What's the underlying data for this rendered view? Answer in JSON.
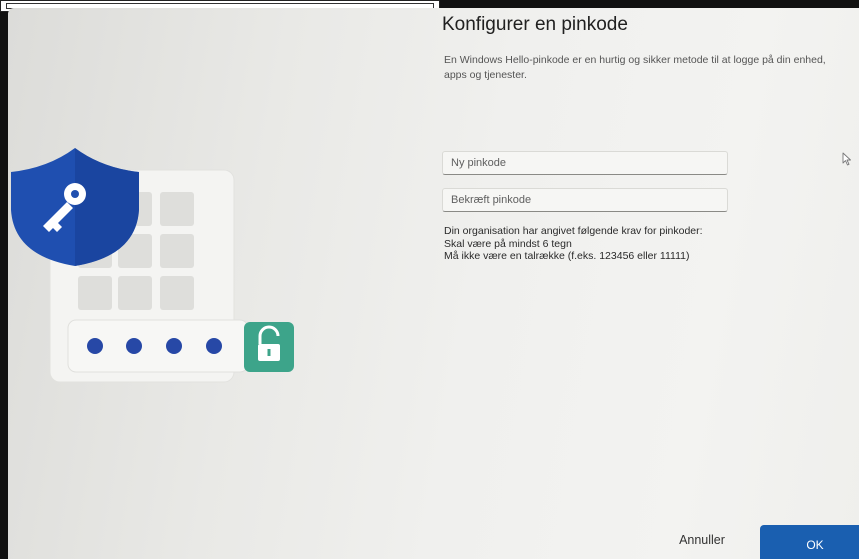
{
  "dialog": {
    "title": "Konfigurer en pinkode",
    "description": "En Windows Hello-pinkode er en hurtig og sikker metode til at logge på din enhed, apps og tjenester."
  },
  "fields": {
    "new_pin_placeholder": "Ny pinkode",
    "confirm_pin_placeholder": "Bekræft pinkode"
  },
  "requirements": {
    "intro": "Din organisation har angivet følgende krav for pinkoder:",
    "rule_1": "Skal være på mindst 6 tegn",
    "rule_2": "Må ikke være en talrække (f.eks. 123456 eller 11111)"
  },
  "buttons": {
    "cancel": "Annuller",
    "ok": "OK"
  },
  "illustration": {
    "icons": [
      "shield-key-icon",
      "keypad-icon",
      "pin-dots-icon",
      "unlocked-padlock-icon"
    ],
    "pin_dot_count": 4
  },
  "colors": {
    "accent": "#1a5fb0",
    "shield": "#1f4fb0",
    "pin_dot": "#2748a6",
    "lock_tile": "#3da48a"
  }
}
